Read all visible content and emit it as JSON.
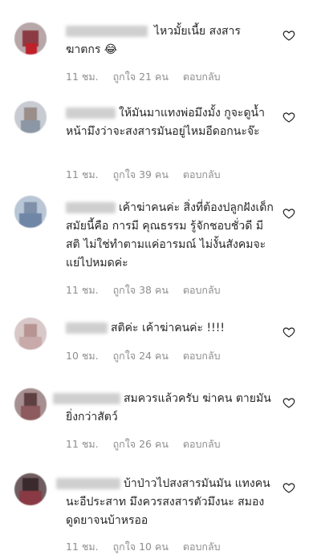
{
  "comments": [
    {
      "text": "ไหวมั้ยเนี้ย สงสาร ฆาตกร 😂",
      "time": "11 ชม.",
      "likes": "ถูกใจ 21 คน",
      "reply": "ตอบกลับ"
    },
    {
      "text": "ให้มันมาแทงพ่อมึงมั้ง กูจะดูน้ำหน้ามึงว่าจะสงสารมันอยู่ไหมอีดอกนะจ๊ะ",
      "time": "11 ชม.",
      "likes": "ถูกใจ 39 คน",
      "reply": "ตอบกลับ"
    },
    {
      "text": "เค้าฆ่าคนค่ะ สิ่งที่ต้องปลูกฝังเด็กสมัยนี้คือ การมี คุณธรรม รู้จักชอบชั่วดี มีสติ ไม่ใช่ทำตามแค่อารมณ์ ไม่งั้นสังคมจะแย่ไปหมดค่ะ",
      "time": "11 ชม.",
      "likes": "ถูกใจ 38 คน",
      "reply": "ตอบกลับ"
    },
    {
      "text": "สติค่ะ เค้าฆ่าคนค่ะ !!!!",
      "time": "10 ชม.",
      "likes": "ถูกใจ 24 คน",
      "reply": "ตอบกลับ"
    },
    {
      "text": "สมควรแล้วครับ ฆ่าคน ตายมันยิ่งกว่าสัตว์",
      "time": "11 ชม.",
      "likes": "ถูกใจ 26 คน",
      "reply": "ตอบกลับ"
    },
    {
      "text": "บ้าป่าวไปสงสารมันมัน แทงคนนะอีประสาท มึงควรสงสารตัวมึงนะ สมอง ดูดยาจนบ้าหรออ",
      "time": "11 ชม.",
      "likes": "ถูกใจ 10 คน",
      "reply": "ตอบกลับ"
    }
  ],
  "icons": {
    "like": "heart-outline-icon"
  }
}
